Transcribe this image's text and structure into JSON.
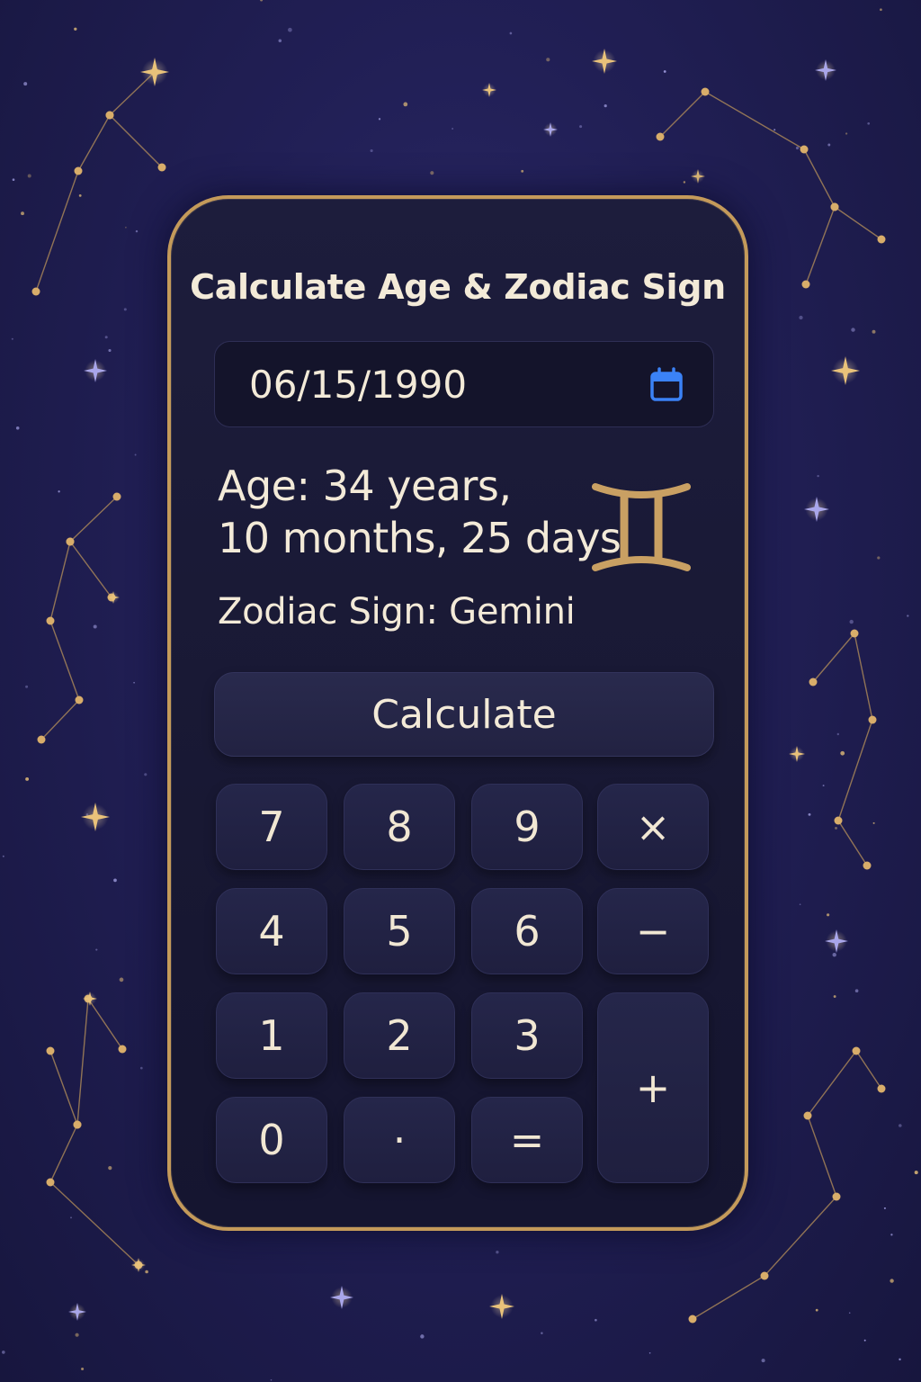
{
  "app": {
    "title": "Calculate Age & Zodiac Sign"
  },
  "date_input": {
    "value": "06/15/1990",
    "icon": "calendar-icon"
  },
  "result": {
    "age_line1": "Age: 34 years,",
    "age_line2": "10 months, 25 days",
    "zodiac_label": "Zodiac Sign: Gemini",
    "zodiac_symbol_icon": "gemini-icon"
  },
  "calculate_button": {
    "label": "Calculate"
  },
  "keypad": {
    "k7": "7",
    "k8": "8",
    "k9": "9",
    "multiply": "×",
    "k4": "4",
    "k5": "5",
    "k6": "6",
    "minus": "−",
    "k1": "1",
    "k2": "2",
    "k3": "3",
    "plus": "+",
    "k0": "0",
    "dot": "·",
    "equals": "="
  },
  "colors": {
    "background": "#211f55",
    "frame_gold": "#c49a5a",
    "text_cream": "#f3ead8",
    "calendar_blue": "#3b82f6",
    "star_gold": "#e9c27a",
    "star_lavender": "#a9a6ea"
  }
}
